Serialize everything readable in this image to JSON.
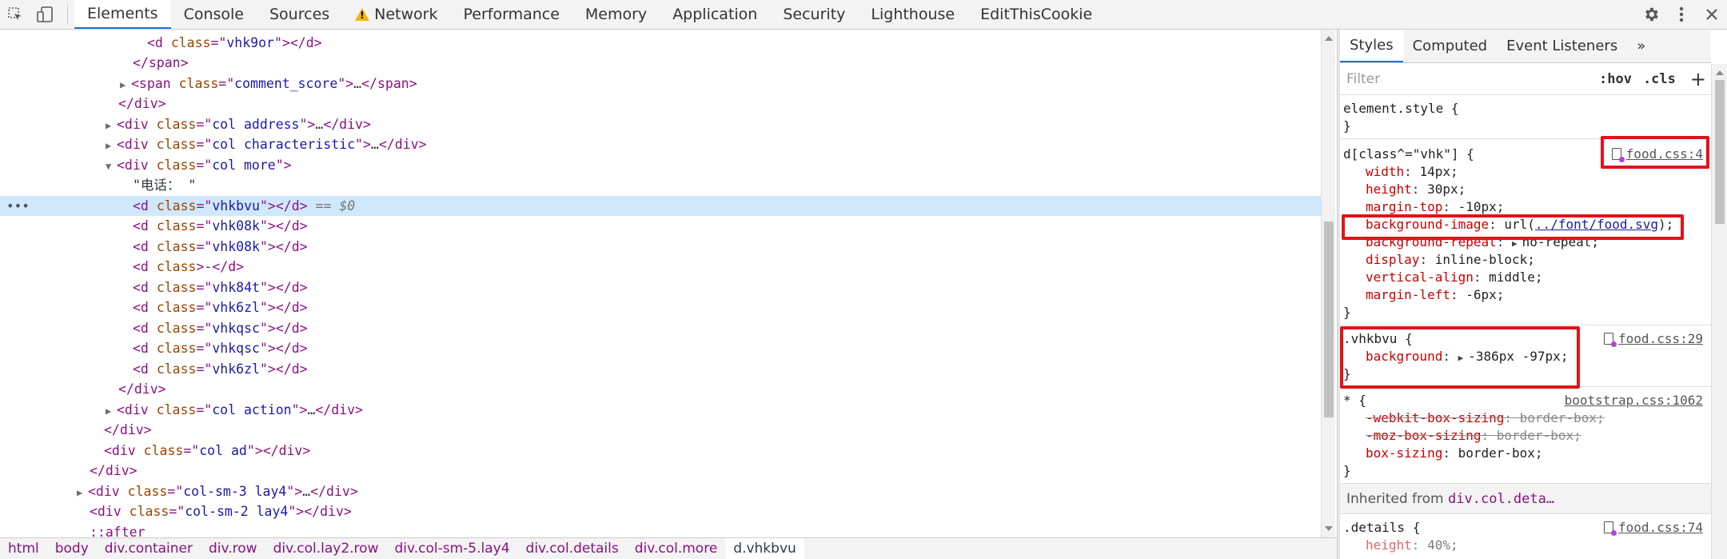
{
  "toolbar": {
    "tabs": [
      "Elements",
      "Console",
      "Sources",
      "Network",
      "Performance",
      "Memory",
      "Application",
      "Security",
      "Lighthouse",
      "EditThisCookie"
    ],
    "active_tab": "Elements"
  },
  "dom": {
    "selected_suffix": "== $0",
    "ellipsis": "…",
    "lines": [
      {
        "tag": "d",
        "class": "vhk9or",
        "text": "<d class=\"vhk9or\"></d>"
      },
      {
        "text": "</span>"
      },
      {
        "text": "<span class=\"comment_score\">…</span>"
      },
      {
        "text": "</div>"
      },
      {
        "text": "<div class=\"col address\">…</div>"
      },
      {
        "text": "<div class=\"col characteristic\">…</div>"
      },
      {
        "text": "<div class=\"col more\">"
      },
      {
        "text": "\"电话：\""
      },
      {
        "text": "<d class=\"vhkbvu\"></d>"
      },
      {
        "text": "<d class=\"vhk08k\"></d>"
      },
      {
        "text": "<d class=\"vhk08k\"></d>"
      },
      {
        "text": "<d class>-</d>"
      },
      {
        "text": "<d class=\"vhk84t\"></d>"
      },
      {
        "text": "<d class=\"vhk6zl\"></d>"
      },
      {
        "text": "<d class=\"vhkqsc\"></d>"
      },
      {
        "text": "<d class=\"vhkqsc\"></d>"
      },
      {
        "text": "<d class=\"vhk6zl\"></d>"
      },
      {
        "text": "</div>"
      },
      {
        "text": "<div class=\"col action\">…</div>"
      },
      {
        "text": "</div>"
      },
      {
        "text": "<div class=\"col ad\"></div>"
      },
      {
        "text": "</div>"
      },
      {
        "text": "<div class=\"col-sm-3 lay4\">…</div>"
      },
      {
        "text": "<div class=\"col-sm-2 lay4\"></div>"
      },
      {
        "text": "::after"
      }
    ]
  },
  "styles": {
    "tabs": [
      "Styles",
      "Computed",
      "Event Listeners",
      "»"
    ],
    "filter_placeholder": "Filter",
    "hov": ":hov",
    "cls": ".cls",
    "plus": "+",
    "element_style": "element.style {",
    "close": "}",
    "rule1": {
      "selector": "d[class^=\"vhk\"] {",
      "source": "food.css:4",
      "props": [
        {
          "n": "width",
          "v": "14px;"
        },
        {
          "n": "height",
          "v": "30px;"
        },
        {
          "n": "margin-top",
          "v": "-10px;"
        },
        {
          "n": "background-image",
          "v_pre": "url(",
          "v_link": "../font/food.svg",
          "v_post": ");"
        },
        {
          "n": "background-repeat",
          "v": "no-repeat;"
        },
        {
          "n": "display",
          "v": "inline-block;"
        },
        {
          "n": "vertical-align",
          "v": "middle;"
        },
        {
          "n": "margin-left",
          "v": "-6px;"
        }
      ]
    },
    "rule2": {
      "selector": ".vhkbvu {",
      "source": "food.css:29",
      "prop_name": "background",
      "prop_value": "-386px -97px;"
    },
    "rule3": {
      "selector": "* {",
      "source": "bootstrap.css:1062",
      "props": [
        {
          "n": "-webkit-box-sizing",
          "v": "border-box;"
        },
        {
          "n": "-moz-box-sizing",
          "v": "border-box;"
        },
        {
          "n": "box-sizing",
          "v": "border-box;"
        }
      ]
    },
    "inherited_label": "Inherited from",
    "inherited_from": "div.col.deta…",
    "rule4": {
      "selector": ".details {",
      "source": "food.css:74",
      "prop_name": "height",
      "prop_value": "40%;"
    }
  },
  "breadcrumb": [
    "html",
    "body",
    "div.container",
    "div.row",
    "div.col.lay2.row",
    "div.col-sm-5.lay4",
    "div.col.details",
    "div.col.more",
    "d.vhkbvu"
  ],
  "colors": {
    "highlight": "#e0141a",
    "tag": "#881280",
    "attr_value": "#1a1aa6",
    "prop_name": "#c80000",
    "accent": "#1a73e8"
  }
}
